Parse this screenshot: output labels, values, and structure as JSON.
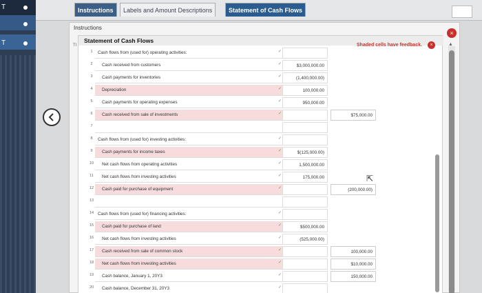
{
  "left_strip": {
    "marker_1": "T",
    "marker_2": "T"
  },
  "top_tabs": [
    {
      "label": "Instructions"
    },
    {
      "label": "Labels and Amount Descriptions"
    },
    {
      "label": "Statement of Cash Flows"
    }
  ],
  "panel": {
    "title": "Instructions",
    "ti_label": "TI",
    "sheet_title": "Statement of Cash Flows",
    "feedback_text": "Shaded cells have feedback.",
    "close_icon": "×",
    "feedback_close_icon": "×"
  },
  "rows": [
    {
      "num": "1",
      "label": "Cash flows from (used for) operating activities:",
      "col1": "",
      "col2": ""
    },
    {
      "num": "2",
      "label": "Cash received from customers",
      "col1": "$3,000,000.00",
      "col2": ""
    },
    {
      "num": "3",
      "label": "Cash payments for inventories",
      "col1": "(1,400,000.00)",
      "col2": ""
    },
    {
      "num": "4",
      "label": "Depreciation",
      "col1": "100,000.00",
      "col2": ""
    },
    {
      "num": "5",
      "label": "Cash payments for operating expenses",
      "col1": "950,000.00",
      "col2": ""
    },
    {
      "num": "6",
      "label": "Cash received from sale of investments",
      "col1": "",
      "col2": "$75,000.00"
    },
    {
      "num": "7",
      "label": "",
      "col1": "",
      "col2": ""
    },
    {
      "num": "8",
      "label": "Cash flows from (used for) investing activities:",
      "col1": "",
      "col2": ""
    },
    {
      "num": "9",
      "label": "Cash payments for income taxes",
      "col1": "$(125,000.00)",
      "col2": ""
    },
    {
      "num": "10",
      "label": "Net cash flows from operating activities",
      "col1": "1,500,000.00",
      "col2": ""
    },
    {
      "num": "11",
      "label": "Net cash flows from investing activities",
      "col1": "175,000.00",
      "col2": ""
    },
    {
      "num": "12",
      "label": "Cash paid for purchase of equipment",
      "col1": "",
      "col2": "(200,000.00)"
    },
    {
      "num": "13",
      "label": "",
      "col1": "",
      "col2": ""
    },
    {
      "num": "14",
      "label": "Cash flows from (used for) financing activities:",
      "col1": "",
      "col2": ""
    },
    {
      "num": "15",
      "label": "Cash paid for purchase of land",
      "col1": "$500,000.00",
      "col2": ""
    },
    {
      "num": "16",
      "label": "Net cash flows from investing activities",
      "col1": "(525,000.00)",
      "col2": ""
    },
    {
      "num": "17",
      "label": "Cash received from sale of common stock",
      "col1": "",
      "col2": "100,000.00"
    },
    {
      "num": "18",
      "label": "Net cash flows from investing activities",
      "col1": "",
      "col2": "$10,000.00"
    },
    {
      "num": "19",
      "label": "Cash balance, January 1, 20Y3",
      "col1": "",
      "col2": "150,000.00"
    },
    {
      "num": "20",
      "label": "Cash balance, December 31, 20Y3",
      "col1": "",
      "col2": ""
    }
  ],
  "colors": {
    "accent": "#2b5c8f",
    "feedback": "#c9302c",
    "shaded": "#f6dcdc"
  }
}
